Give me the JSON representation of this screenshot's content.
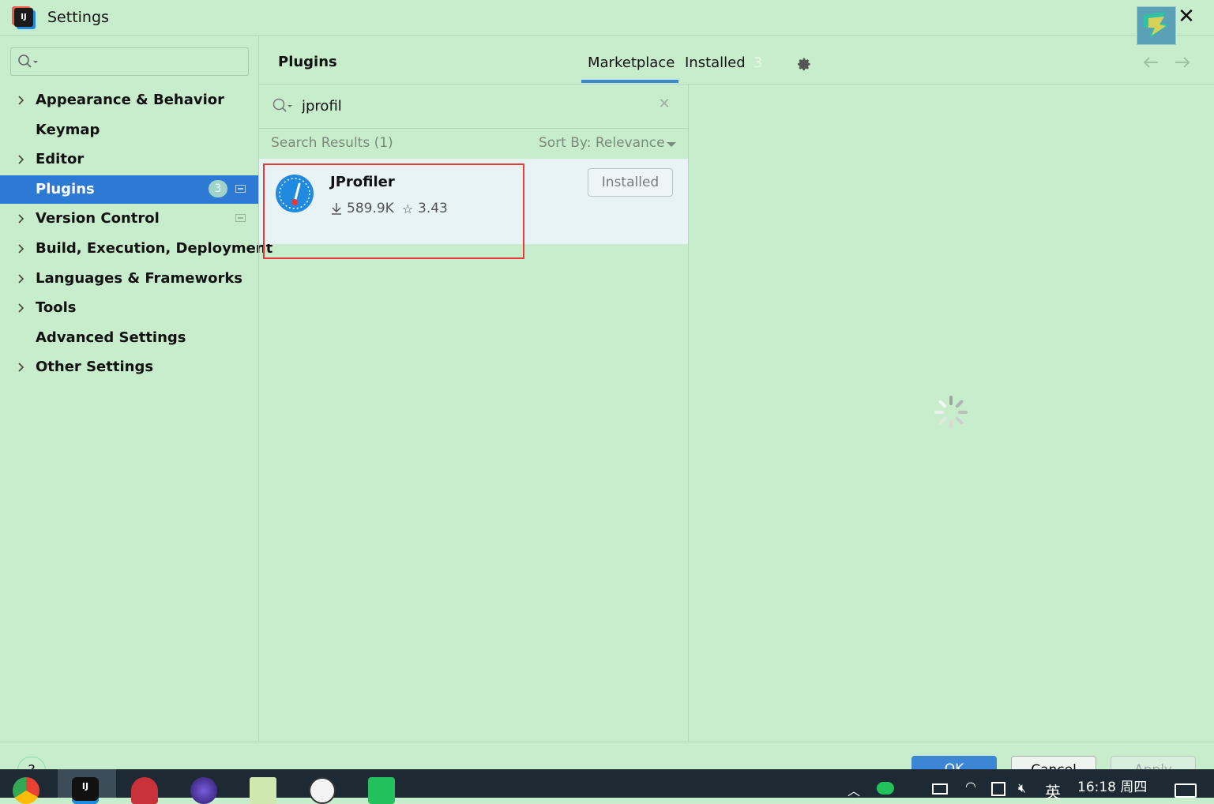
{
  "window": {
    "title": "Settings",
    "close_glyph": "✕"
  },
  "sidebar": {
    "search_placeholder": "",
    "items": [
      {
        "label": "Appearance & Behavior",
        "expandable": true
      },
      {
        "label": "Keymap",
        "expandable": false
      },
      {
        "label": "Editor",
        "expandable": true
      },
      {
        "label": "Plugins",
        "expandable": false,
        "selected": true,
        "badge": "3"
      },
      {
        "label": "Version Control",
        "expandable": true
      },
      {
        "label": "Build, Execution, Deployment",
        "expandable": true
      },
      {
        "label": "Languages & Frameworks",
        "expandable": true
      },
      {
        "label": "Tools",
        "expandable": true
      },
      {
        "label": "Advanced Settings",
        "expandable": false
      },
      {
        "label": "Other Settings",
        "expandable": true
      }
    ]
  },
  "main": {
    "title": "Plugins",
    "tabs": {
      "marketplace": "Marketplace",
      "installed": "Installed",
      "installed_count": "3"
    },
    "search": {
      "value": "jprofil",
      "placeholder": ""
    },
    "results_label": "Search Results (1)",
    "sort_label": "Sort By: Relevance",
    "results": [
      {
        "name": "JProfiler",
        "downloads": "589.9K",
        "rating": "3.43",
        "button": "Installed"
      }
    ]
  },
  "footer": {
    "help": "?",
    "ok": "OK",
    "cancel": "Cancel",
    "apply": "Apply"
  },
  "taskbar": {
    "apps": [
      "chrome-icon",
      "intellij-icon",
      "snail-app-icon",
      "k-app-icon",
      "notepad-icon",
      "panda-app-icon",
      "green-app-icon"
    ],
    "tray": {
      "ime": "英",
      "time": "16:18 周四"
    }
  },
  "colors": {
    "background": "#c7edcc",
    "accent": "#2c7ad3",
    "highlight": "#e8383a"
  }
}
